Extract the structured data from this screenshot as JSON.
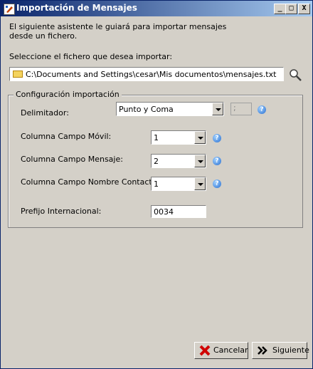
{
  "window": {
    "title": "Importación de Mensajes"
  },
  "titlebar_buttons": {
    "minimize": "_",
    "maximize": "□",
    "close": "X"
  },
  "intro": "El siguiente asistente le guiará para importar mensajes desde un fichero.",
  "file": {
    "label": "Seleccione el fichero que desea importar:",
    "path": "C:\\Documents and Settings\\cesar\\Mis documentos\\mensajes.txt"
  },
  "config": {
    "title": "Configuración importación",
    "delimiter": {
      "label": "Delimitador:",
      "value": "Punto y Coma",
      "separator": ";"
    },
    "movil": {
      "label": "Columna Campo Móvil:",
      "value": "1"
    },
    "mensaje": {
      "label": "Columna Campo Mensaje:",
      "value": "2"
    },
    "contacto": {
      "label": "Columna Campo Nombre Contacto:",
      "value": "1"
    },
    "prefijo": {
      "label": "Prefijo Internacional:",
      "value": "0034"
    }
  },
  "buttons": {
    "cancel": "Cancelar",
    "next": "Siguiente"
  },
  "icons": {
    "help": "?"
  }
}
